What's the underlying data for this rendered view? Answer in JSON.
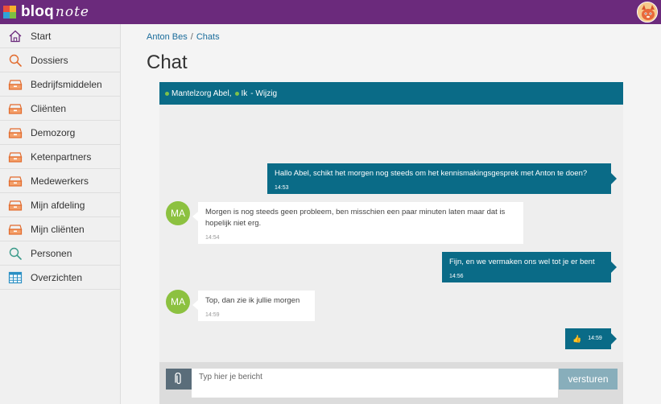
{
  "app": {
    "logo_text": "bloq",
    "logo_script": "note"
  },
  "sidebar": {
    "items": [
      {
        "label": "Start",
        "icon": "home-icon"
      },
      {
        "label": "Dossiers",
        "icon": "search-icon"
      },
      {
        "label": "Bedrijfsmiddelen",
        "icon": "drawer-icon"
      },
      {
        "label": "Cliënten",
        "icon": "drawer-icon"
      },
      {
        "label": "Demozorg",
        "icon": "drawer-icon"
      },
      {
        "label": "Ketenpartners",
        "icon": "drawer-icon"
      },
      {
        "label": "Medewerkers",
        "icon": "drawer-icon"
      },
      {
        "label": "Mijn afdeling",
        "icon": "drawer-icon"
      },
      {
        "label": "Mijn cliënten",
        "icon": "drawer-icon"
      },
      {
        "label": "Personen",
        "icon": "search-icon"
      },
      {
        "label": "Overzichten",
        "icon": "table-icon"
      }
    ]
  },
  "breadcrumb": {
    "items": [
      "Anton Bes",
      "Chats"
    ],
    "separator": "/"
  },
  "page": {
    "title": "Chat"
  },
  "chat": {
    "participants": [
      "Mantelzorg Abel,",
      "Ik"
    ],
    "edit_label": "- Wijzig",
    "messages": [
      {
        "dir": "out",
        "text": "Hallo Abel, schikt het morgen nog steeds om het kennismakingsgesprek met Anton te doen?",
        "time": "14:53"
      },
      {
        "dir": "in",
        "avatar": "MA",
        "text": "Morgen is nog steeds geen probleem, ben misschien een paar minuten laten maar dat is hopelijk niet erg.",
        "time": "14:54"
      },
      {
        "dir": "out",
        "text": "Fijn, en we vermaken ons wel tot je er bent",
        "time": "14:56"
      },
      {
        "dir": "in",
        "avatar": "MA",
        "text": "Top, dan zie ik jullie morgen",
        "time": "14:59"
      },
      {
        "dir": "out",
        "emoji": "👍",
        "time": "14:59"
      }
    ]
  },
  "composer": {
    "placeholder": "Typ hier je bericht",
    "send_label": "versturen"
  },
  "colors": {
    "topbar": "#6b2a7c",
    "accent": "#0a6b87",
    "online": "#7dc14a",
    "avatar": "#8cc140"
  }
}
